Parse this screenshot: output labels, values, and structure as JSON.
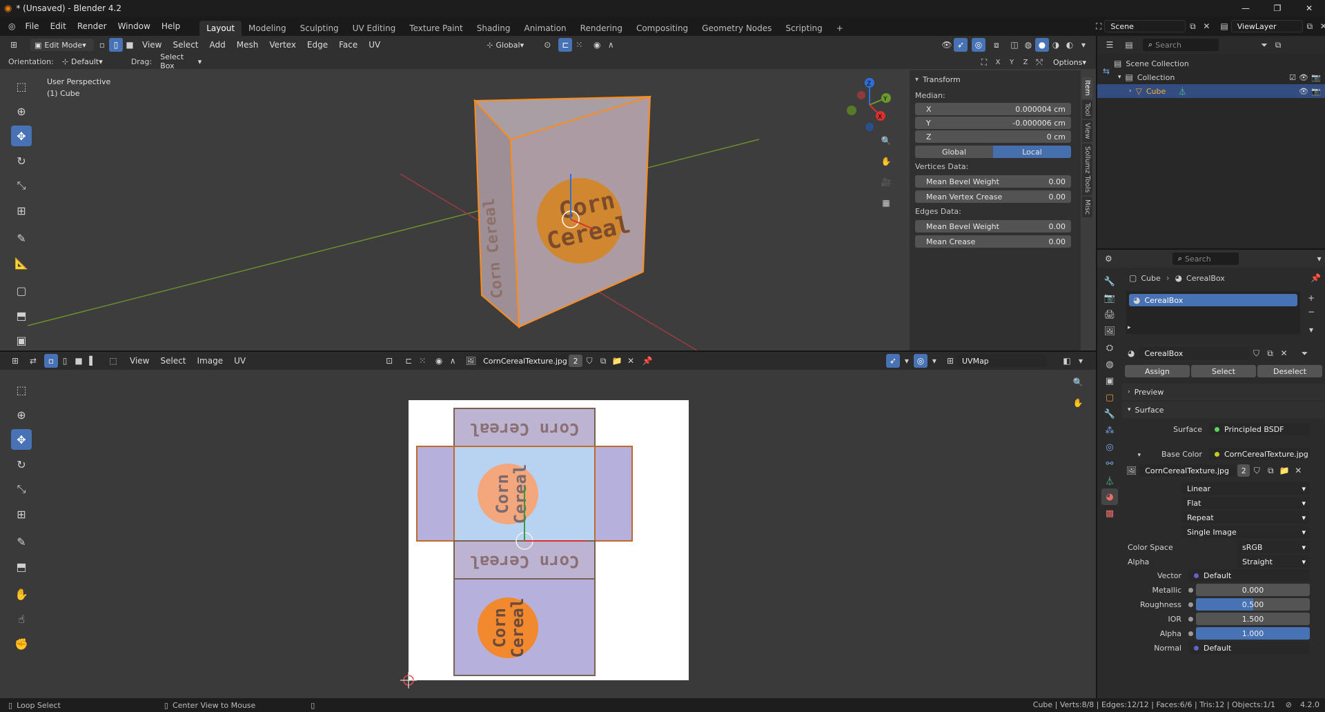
{
  "titlebar": {
    "title": "* (Unsaved) - Blender 4.2",
    "min": "—",
    "max": "❐",
    "close": "✕"
  },
  "menu": {
    "items": [
      "File",
      "Edit",
      "Render",
      "Window",
      "Help"
    ]
  },
  "workspaces": [
    "Layout",
    "Modeling",
    "Sculpting",
    "UV Editing",
    "Texture Paint",
    "Shading",
    "Animation",
    "Rendering",
    "Compositing",
    "Geometry Nodes",
    "Scripting",
    "+"
  ],
  "topright": {
    "scene": "Scene",
    "viewlayer": "ViewLayer"
  },
  "viewport": {
    "mode": "Edit Mode",
    "menus": [
      "View",
      "Select",
      "Add",
      "Mesh",
      "Vertex",
      "Edge",
      "Face",
      "UV"
    ],
    "transform_orientation": "Global",
    "orientation_label": "Orientation:",
    "orientation_value": "Default",
    "drag_label": "Drag:",
    "drag_value": "Select Box",
    "options": "Options",
    "persp": "User Perspective",
    "object": "(1) Cube",
    "axis": {
      "x": "X",
      "y": "Y",
      "z": "Z"
    },
    "tabs": [
      "Item",
      "Tool",
      "View",
      "Sollumz Tools",
      "Misc"
    ],
    "npanel": {
      "transform_title": "Transform",
      "median": "Median:",
      "x_label": "X",
      "x_value": "0.000004 cm",
      "y_label": "Y",
      "y_value": "-0.000006 cm",
      "z_label": "Z",
      "z_value": "0 cm",
      "global": "Global",
      "local": "Local",
      "vertices_data": "Vertices Data:",
      "mean_bevel_v": "Mean Bevel Weight",
      "mean_bevel_v_value": "0.00",
      "mean_vertex_crease": "Mean Vertex Crease",
      "mean_vertex_crease_value": "0.00",
      "edges_data": "Edges Data:",
      "mean_bevel_e": "Mean Bevel Weight",
      "mean_bevel_e_value": "0.00",
      "mean_crease": "Mean Crease",
      "mean_crease_value": "0.00"
    },
    "box_text": "Corn Cereal",
    "box_text_top": "Corn",
    "box_text_bottom": "Cereal"
  },
  "uv": {
    "menus": [
      "View",
      "Select",
      "Image",
      "UV"
    ],
    "image": "CornCerealTexture.jpg",
    "users": "2",
    "uvmap": "UVMap"
  },
  "outliner": {
    "search": "Search",
    "scene_collection": "Scene Collection",
    "collection": "Collection",
    "cube": "Cube"
  },
  "props": {
    "search": "Search",
    "breadcrumb_obj": "Cube",
    "breadcrumb_mat": "CerealBox",
    "slot": "CerealBox",
    "material": "CerealBox",
    "assign": "Assign",
    "select": "Select",
    "deselect": "Deselect",
    "preview": "Preview",
    "surface_section": "Surface",
    "surface_label": "Surface",
    "surface_value": "Principled BSDF",
    "base_color_label": "Base Color",
    "base_color_value": "CornCerealTexture.jpg",
    "image_name": "CornCerealTexture.jpg",
    "image_users": "2",
    "interp": "Linear",
    "proj": "Flat",
    "ext": "Repeat",
    "source": "Single Image",
    "colorspace_label": "Color Space",
    "colorspace_value": "sRGB",
    "alpha_mode_label": "Alpha",
    "alpha_mode_value": "Straight",
    "vector_label": "Vector",
    "vector_value": "Default",
    "metallic_label": "Metallic",
    "metallic_value": "0.000",
    "roughness_label": "Roughness",
    "roughness_value": "0.500",
    "roughness_fraction": 0.5,
    "ior_label": "IOR",
    "ior_value": "1.500",
    "alpha_label": "Alpha",
    "alpha_value": "1.000",
    "alpha_fraction": 1.0,
    "normal_label": "Normal",
    "normal_value": "Default"
  },
  "status": {
    "loop_select": "Loop Select",
    "center_view": "Center View to Mouse",
    "stats": "Cube | Verts:8/8 | Edges:12/12 | Faces:6/6 | Tris:12 | Objects:1/1",
    "version": "4.2.0"
  },
  "colors": {
    "accent": "#4772b3",
    "selection": "#ff8c1a",
    "background": "#3d3d3d"
  }
}
